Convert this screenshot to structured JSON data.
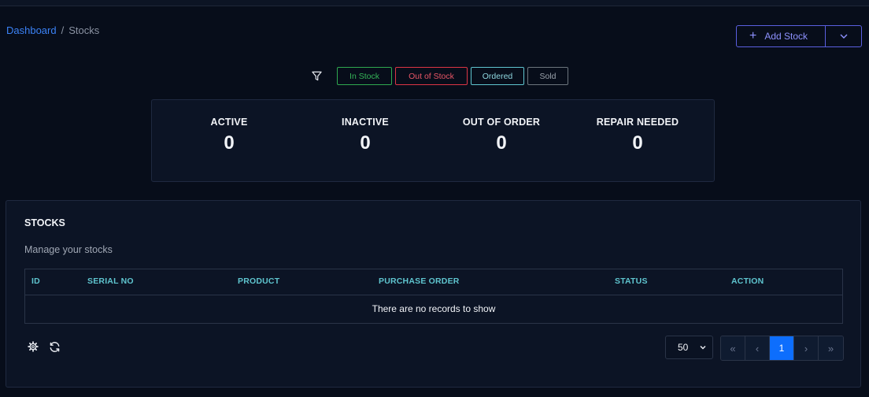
{
  "breadcrumb": {
    "home": "Dashboard",
    "separator": "/",
    "current": "Stocks"
  },
  "header": {
    "add_label": "Add Stock",
    "add_icon": "plus-icon",
    "dropdown_icon": "chevron-down-icon"
  },
  "filters": {
    "icon": "filter-icon",
    "in_stock": "In Stock",
    "out_of_stock": "Out of Stock",
    "ordered": "Ordered",
    "sold": "Sold"
  },
  "stats": [
    {
      "label": "ACTIVE",
      "value": "0"
    },
    {
      "label": "INACTIVE",
      "value": "0"
    },
    {
      "label": "OUT OF ORDER",
      "value": "0"
    },
    {
      "label": "REPAIR NEEDED",
      "value": "0"
    }
  ],
  "card": {
    "title": "STOCKS",
    "subtitle": "Manage your stocks"
  },
  "table": {
    "columns": [
      "ID",
      "SERIAL NO",
      "PRODUCT",
      "PURCHASE ORDER",
      "STATUS",
      "ACTION"
    ],
    "empty_message": "There are no records to show"
  },
  "footer": {
    "per_page": "50",
    "pager": {
      "first": "«",
      "prev": "‹",
      "page": "1",
      "next": "›",
      "last": "»"
    }
  },
  "colors": {
    "background": "#070d1a",
    "panel": "#0c1425",
    "accent": "#5a5fe0",
    "link": "#3b82f6",
    "header_text": "#5fc5cf",
    "active_page": "#0d6efd"
  }
}
